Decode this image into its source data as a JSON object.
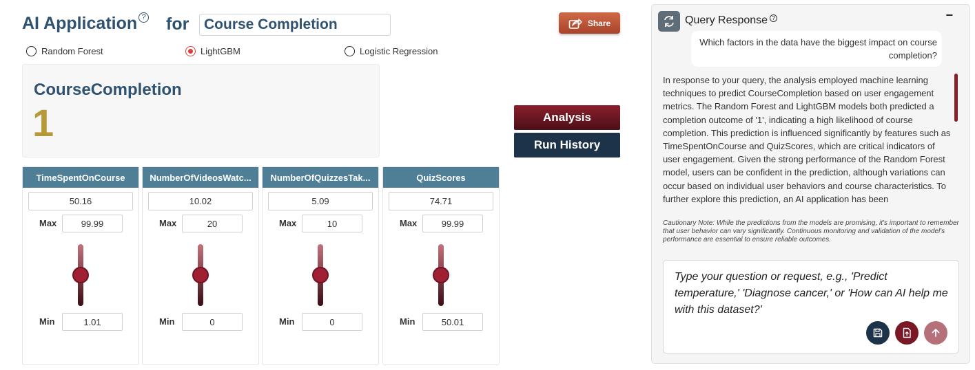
{
  "header": {
    "title": "AI Application",
    "for_label": "for",
    "target_value": "Course Completion",
    "share_label": "Share"
  },
  "models": [
    {
      "label": "Random Forest",
      "selected": false
    },
    {
      "label": "LightGBM",
      "selected": true
    },
    {
      "label": "Logistic Regression",
      "selected": false
    }
  ],
  "prediction": {
    "label": "CourseCompletion",
    "value": "1"
  },
  "buttons": {
    "analysis": "Analysis",
    "run_history": "Run History"
  },
  "features": [
    {
      "name": "TimeSpentOnCourse",
      "value": "50.16",
      "max_label": "Max",
      "max": "99.99",
      "min_label": "Min",
      "min": "1.01",
      "level": 0.5
    },
    {
      "name": "NumberOfVideosWatc...",
      "value": "10.02",
      "max_label": "Max",
      "max": "20",
      "min_label": "Min",
      "min": "0",
      "level": 0.5
    },
    {
      "name": "NumberOfQuizzesTak...",
      "value": "5.09",
      "max_label": "Max",
      "max": "10",
      "min_label": "Min",
      "min": "0",
      "level": 0.5
    },
    {
      "name": "QuizScores",
      "value": "74.71",
      "max_label": "Max",
      "max": "99.99",
      "min_label": "Min",
      "min": "50.01",
      "level": 0.5
    }
  ],
  "query": {
    "title": "Query Response",
    "minimize": "−",
    "user_question": "Which factors in the data have the biggest impact on course completion?",
    "response": "In response to your query, the analysis employed machine learning techniques to predict CourseCompletion based on user engagement metrics. The Random Forest and LightGBM models both predicted a completion outcome of '1', indicating a high likelihood of course completion. This prediction is influenced significantly by features such as TimeSpentOnCourse and QuizScores, which are critical indicators of user engagement. Given the strong performance of the Random Forest model, users can be confident in the prediction, although variations can occur based on individual user behaviors and course characteristics. To further explore this prediction, an AI application has been",
    "caution": "Cautionary Note: While the predictions from the models are promising, it's important to remember that user behavior can vary significantly. Continuous monitoring and validation of the model's performance are essential to ensure reliable outcomes.",
    "input_placeholder": "Type your question or request, e.g., 'Predict temperature,' 'Diagnose cancer,' or 'How can AI help me with this dataset?'"
  },
  "colors": {
    "title": "#2f5270",
    "prediction_value": "#b69a3a",
    "card_header": "#4f7f96",
    "analysis_button": "#8a1f2c",
    "history_button": "#1d3349",
    "share_button": "#c0583b",
    "radio_selected": "#d9403a"
  }
}
